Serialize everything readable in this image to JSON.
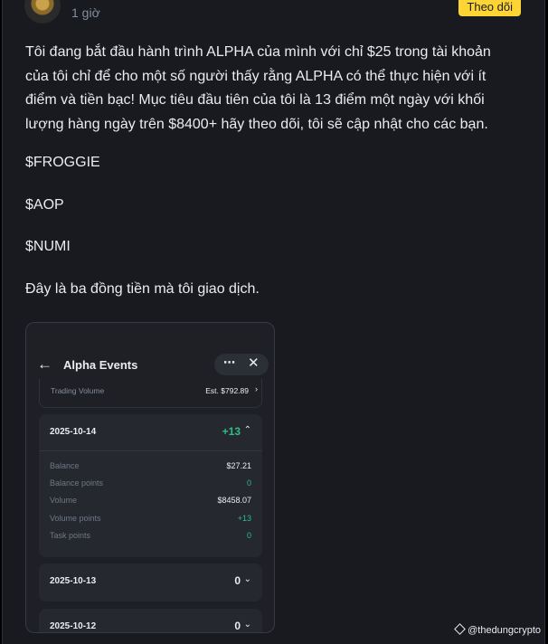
{
  "post": {
    "time": "1 giờ",
    "follow_label": "Theo dõi",
    "body": [
      "Tôi đang bắt đầu hành trình ALPHA của mình với chỉ $25 trong tài khoản của tôi chỉ để cho một số người thấy rằng ALPHA có thể thực hiện với ít điểm và tiền bạc! Mục tiêu đầu tiên của tôi là 13 điểm một ngày với khối lượng hàng ngày trên $8400+ hãy theo dõi, tôi sẽ cập nhật cho các bạn."
    ],
    "tags": [
      "$FROGGIE",
      "$AOP",
      "$NUMI"
    ],
    "closing": "Đây là ba đồng tiền mà tôi giao dịch."
  },
  "screenshot": {
    "title": "Alpha Events",
    "more_icon": "⋯",
    "close_icon": "✕",
    "back_icon": "←",
    "trading_volume_label": "Trading Volume",
    "trading_volume_value": "Est. $792.89",
    "days": [
      {
        "date": "2025-10-14",
        "score": "+13",
        "rows": [
          {
            "label": "Balance",
            "value": "$27.21",
            "green": false
          },
          {
            "label": "Balance points",
            "value": "0",
            "green": true
          },
          {
            "label": "Volume",
            "value": "$8458.07",
            "green": false
          },
          {
            "label": "Volume points",
            "value": "+13",
            "green": true
          },
          {
            "label": "Task points",
            "value": "0",
            "green": true
          }
        ]
      },
      {
        "date": "2025-10-13",
        "score": "0"
      },
      {
        "date": "2025-10-12",
        "score": "0"
      }
    ]
  },
  "watermark": "@thedungcrypto",
  "colors": {
    "accent": "#fcd535",
    "positive": "#2ebd85",
    "background": "#181a20"
  }
}
